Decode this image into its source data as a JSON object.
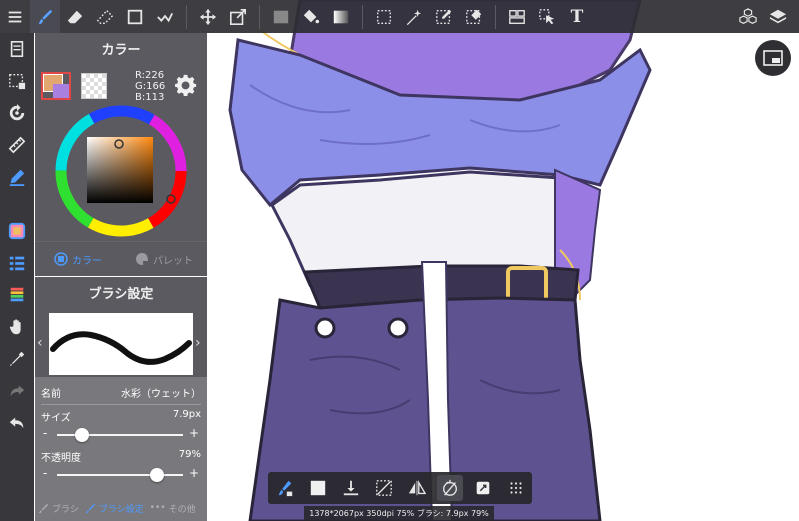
{
  "colors": {
    "accent": "#4d9bff",
    "foreground": "#e2a671",
    "background_swatch": "#a780e0",
    "panel": "#4e4e54",
    "toolbar": "#2d2d32"
  },
  "top_toolbar": {
    "left_tools": [
      "menu-icon",
      "brush-icon",
      "eraser-icon",
      "fill-eraser-icon",
      "rectangle-icon",
      "correction-icon"
    ],
    "middle_tools": [
      "move-icon",
      "transform-icon",
      "fill-color-icon",
      "paint-bucket-icon",
      "gradient-icon"
    ],
    "selection_tools": [
      "select-rect-icon",
      "magic-wand-icon",
      "select-pen-icon",
      "select-eraser-icon"
    ],
    "other_tools": [
      "panel-layout-icon",
      "select-cursor-icon"
    ],
    "text_tool_label": "T",
    "right_tools": [
      "materials-icon",
      "layers-icon"
    ]
  },
  "left_toolbar": [
    "page-icon",
    "selection-icon",
    "rotate-icon",
    "ruler-icon",
    "pen-blue-icon",
    "color-panel-icon",
    "layer-list-icon",
    "color-bars-icon",
    "hand-icon",
    "eyedropper-icon",
    "redo-icon",
    "undo-icon"
  ],
  "color_panel": {
    "title": "カラー",
    "rgb": {
      "r": "R:226",
      "g": "G:166",
      "b": "B:113"
    },
    "tabs": [
      {
        "label": "カラー",
        "active": true
      },
      {
        "label": "パレット",
        "active": false
      }
    ]
  },
  "brush_panel": {
    "title": "ブラシ設定",
    "name_label": "名前",
    "name_value": "水彩（ウェット）",
    "size_label": "サイズ",
    "size_value": "7.9px",
    "size_fraction": 0.2,
    "opacity_label": "不透明度",
    "opacity_value": "79%",
    "opacity_fraction": 0.79,
    "tabs": [
      {
        "label": "ブラシ",
        "active": false
      },
      {
        "label": "ブラシ設定",
        "active": true
      },
      {
        "label": "その他",
        "active": false
      }
    ]
  },
  "quick_bar": [
    "brush-quick-icon",
    "fill-square-icon",
    "download-icon",
    "deselect-icon",
    "flip-icon",
    "rotate-reset-icon",
    "fullscreen-icon",
    "grid-dots-icon"
  ],
  "status": "1378*2067px 350dpi 75% ブラシ: 7.9px 79%"
}
